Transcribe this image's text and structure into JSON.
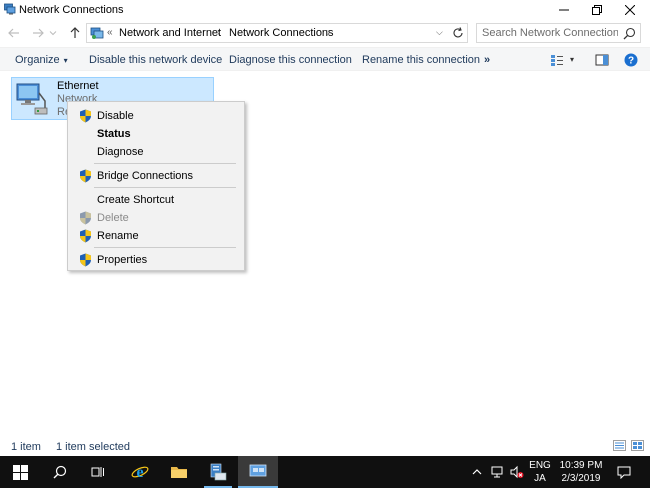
{
  "window": {
    "title": "Network Connections",
    "icon": "network-connections-icon"
  },
  "address": {
    "overflow": "«",
    "breadcrumbs": [
      "Network and Internet",
      "Network Connections"
    ],
    "separator": "›",
    "dropdown": "⌵"
  },
  "search": {
    "placeholder": "Search Network Connections"
  },
  "commandbar": {
    "organize": "Organize",
    "caret": "▾",
    "disable": "Disable this network device",
    "diagnose": "Diagnose this connection",
    "rename": "Rename this connection",
    "more": "»"
  },
  "item": {
    "name": "Ethernet",
    "network": "Network",
    "device_partial": "Re"
  },
  "context_menu": {
    "items": [
      {
        "label": "Disable",
        "shield": true,
        "bold": false,
        "disabled": false
      },
      {
        "label": "Status",
        "shield": false,
        "bold": true,
        "disabled": false
      },
      {
        "label": "Diagnose",
        "shield": false,
        "bold": false,
        "disabled": false
      },
      {
        "label": "Bridge Connections",
        "shield": true,
        "bold": false,
        "disabled": false
      },
      {
        "label": "Create Shortcut",
        "shield": false,
        "bold": false,
        "disabled": false
      },
      {
        "label": "Delete",
        "shield": true,
        "bold": false,
        "disabled": true
      },
      {
        "label": "Rename",
        "shield": true,
        "bold": false,
        "disabled": false
      },
      {
        "label": "Properties",
        "shield": true,
        "bold": false,
        "disabled": false
      }
    ]
  },
  "status": {
    "count": "1 item",
    "selected": "1 item selected"
  },
  "taskbar": {
    "lang_top": "ENG",
    "lang_bottom": "JA",
    "time": "10:39 PM",
    "date": "2/3/2019"
  },
  "colors": {
    "selection_bg": "#cce8ff",
    "selection_border": "#99d1ff",
    "link_text": "#1e395b",
    "taskbar_bg": "#101010",
    "accent": "#76b9ed"
  }
}
